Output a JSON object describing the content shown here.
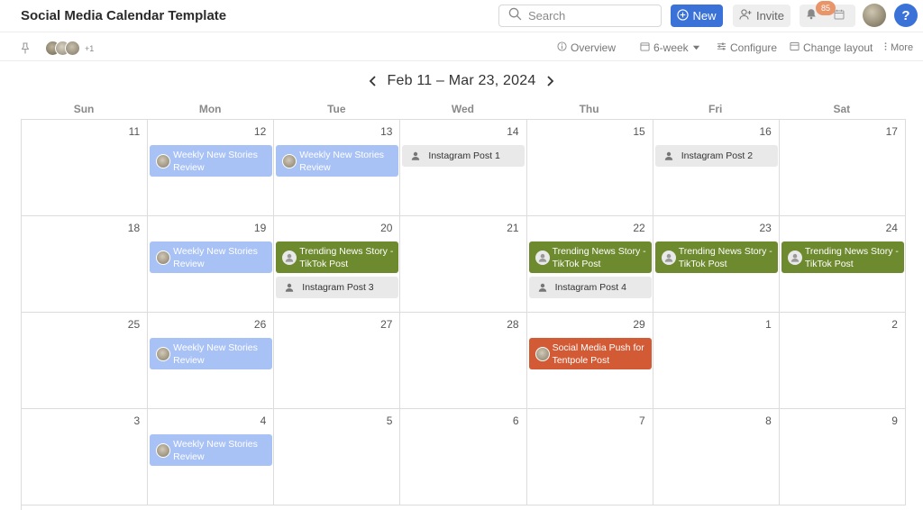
{
  "header": {
    "title": "Social Media Calendar Template",
    "search_placeholder": "Search",
    "new_label": "New",
    "invite_label": "Invite",
    "notification_count": "85"
  },
  "toolbar": {
    "member_extra": "+1",
    "overview_label": "Overview",
    "view_label": "6-week",
    "configure_label": "Configure",
    "change_layout_label": "Change layout",
    "more_label": "More"
  },
  "calendar": {
    "range": "Feb 11 – Mar 23, 2024",
    "weekdays": [
      "Sun",
      "Mon",
      "Tue",
      "Wed",
      "Thu",
      "Fri",
      "Sat"
    ],
    "weeks": [
      [
        {
          "day": "11",
          "events": []
        },
        {
          "day": "12",
          "events": [
            {
              "title": "Weekly New Stories Review",
              "style": "blue"
            }
          ]
        },
        {
          "day": "13",
          "events": [
            {
              "title": "Weekly New Stories Review",
              "style": "blue"
            }
          ]
        },
        {
          "day": "14",
          "events": [
            {
              "title": "Instagram Post 1",
              "style": "gray"
            }
          ]
        },
        {
          "day": "15",
          "events": []
        },
        {
          "day": "16",
          "events": [
            {
              "title": "Instagram Post 2",
              "style": "gray"
            }
          ]
        },
        {
          "day": "17",
          "events": []
        }
      ],
      [
        {
          "day": "18",
          "events": []
        },
        {
          "day": "19",
          "events": [
            {
              "title": "Weekly New Stories Review",
              "style": "blue"
            }
          ]
        },
        {
          "day": "20",
          "events": [
            {
              "title": "Trending News Story - TikTok Post",
              "style": "olive"
            },
            {
              "title": "Instagram Post 3",
              "style": "gray"
            }
          ]
        },
        {
          "day": "21",
          "events": []
        },
        {
          "day": "22",
          "events": [
            {
              "title": "Trending News Story - TikTok Post",
              "style": "olive"
            },
            {
              "title": "Instagram Post 4",
              "style": "gray"
            }
          ]
        },
        {
          "day": "23",
          "events": [
            {
              "title": "Trending News Story - TikTok Post",
              "style": "olive"
            }
          ]
        },
        {
          "day": "24",
          "events": [
            {
              "title": "Trending News Story - TikTok Post",
              "style": "olive"
            }
          ]
        }
      ],
      [
        {
          "day": "25",
          "events": []
        },
        {
          "day": "26",
          "events": [
            {
              "title": "Weekly New Stories Review",
              "style": "blue"
            }
          ]
        },
        {
          "day": "27",
          "events": []
        },
        {
          "day": "28",
          "events": []
        },
        {
          "day": "29",
          "events": [
            {
              "title": "Social Media Push for Tentpole Post",
              "style": "red"
            }
          ]
        },
        {
          "day": "1",
          "events": []
        },
        {
          "day": "2",
          "events": []
        }
      ],
      [
        {
          "day": "3",
          "events": []
        },
        {
          "day": "4",
          "events": [
            {
              "title": "Weekly New Stories Review",
              "style": "blue"
            }
          ]
        },
        {
          "day": "5",
          "events": []
        },
        {
          "day": "6",
          "events": []
        },
        {
          "day": "7",
          "events": []
        },
        {
          "day": "8",
          "events": []
        },
        {
          "day": "9",
          "events": []
        }
      ]
    ]
  },
  "colors": {
    "accent": "#3a72d8",
    "event_blue": "#a9c2f5",
    "event_olive": "#6e8a2e",
    "event_red": "#d25a35",
    "event_gray": "#e9e9e9",
    "badge": "#e8956a"
  },
  "icons": {
    "search": "search-icon",
    "new": "plus-circle-icon",
    "invite": "add-user-icon",
    "notifications": "bell-icon",
    "calendar": "calendar-icon",
    "help": "question-icon",
    "pin": "pin-icon",
    "overview": "info-icon",
    "view": "calendar-icon",
    "configure": "sliders-icon",
    "layout": "layout-icon",
    "more": "vertical-dots-icon",
    "prev": "chevron-left-icon",
    "next": "chevron-right-icon"
  },
  "help_label": "?"
}
